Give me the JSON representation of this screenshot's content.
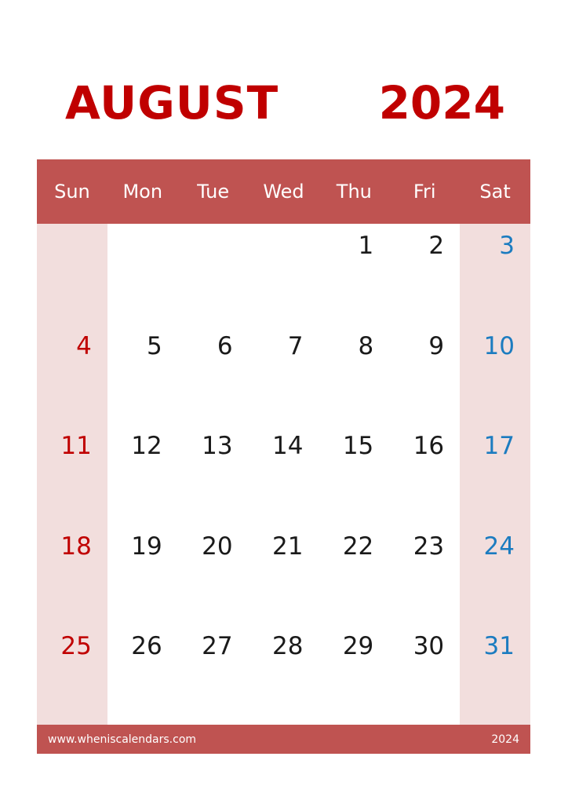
{
  "title": {
    "month": "AUGUST",
    "year": "2024",
    "color": "#C00000"
  },
  "theme": {
    "header_bg": "#BF5351",
    "weekend_bg": "#F2DEDD",
    "sunday_text": "#C00000",
    "saturday_text": "#1C7CC0",
    "weekday_text": "#1a1a1a",
    "page_bg": "#FFFFFF"
  },
  "weekdays": [
    {
      "label": "Sun",
      "kind": "sun"
    },
    {
      "label": "Mon",
      "kind": "weekday"
    },
    {
      "label": "Tue",
      "kind": "weekday"
    },
    {
      "label": "Wed",
      "kind": "weekday"
    },
    {
      "label": "Thu",
      "kind": "weekday"
    },
    {
      "label": "Fri",
      "kind": "weekday"
    },
    {
      "label": "Sat",
      "kind": "sat"
    }
  ],
  "weeks": [
    [
      "",
      "",
      "",
      "",
      "1",
      "2",
      "3"
    ],
    [
      "4",
      "5",
      "6",
      "7",
      "8",
      "9",
      "10"
    ],
    [
      "11",
      "12",
      "13",
      "14",
      "15",
      "16",
      "17"
    ],
    [
      "18",
      "19",
      "20",
      "21",
      "22",
      "23",
      "24"
    ],
    [
      "25",
      "26",
      "27",
      "28",
      "29",
      "30",
      "31"
    ]
  ],
  "footer": {
    "url": "www.wheniscalendars.com",
    "year": "2024"
  }
}
